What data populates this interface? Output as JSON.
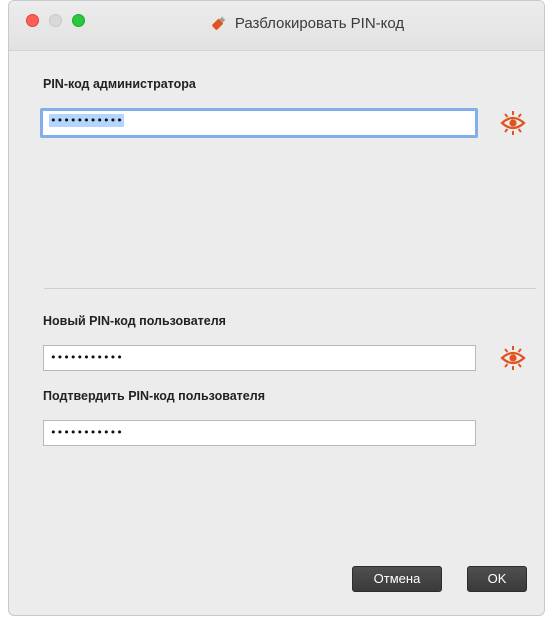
{
  "window": {
    "title": "Разблокировать PIN-код",
    "traffic_lights": {
      "close": "close-button",
      "minimize": "minimize-button",
      "maximize": "maximize-button"
    }
  },
  "admin_pin": {
    "label": "PIN-код администратора",
    "value": "•••••••••••",
    "reveal_icon": "eye-icon"
  },
  "new_pin": {
    "label": "Новый PIN-код пользователя",
    "value": "•••••••••••",
    "reveal_icon": "eye-icon"
  },
  "confirm_pin": {
    "label": "Подтвердить PIN-код пользователя",
    "value": "•••••••••••"
  },
  "buttons": {
    "cancel": "Отмена",
    "ok": "OK"
  },
  "colors": {
    "accent_eye": "#e0541f",
    "focus_ring": "#82aee9",
    "button_bg": "#3f3f3f"
  }
}
